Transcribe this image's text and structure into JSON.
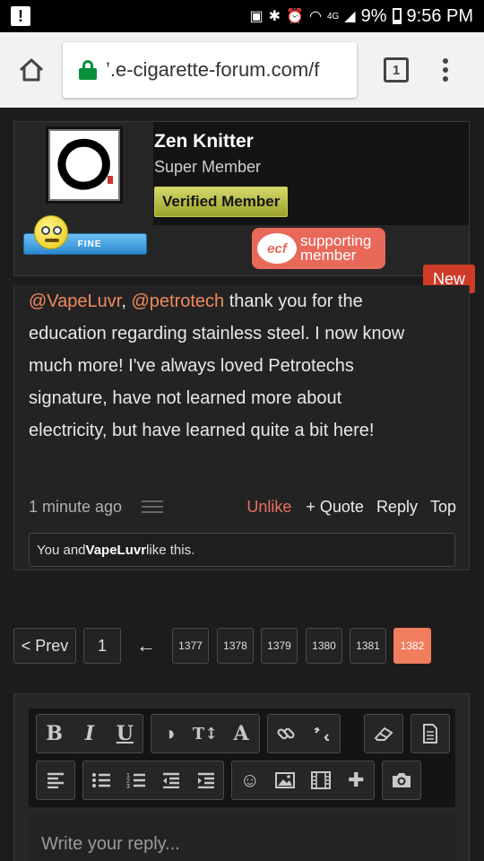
{
  "status_bar": {
    "notification": "!",
    "network": "4G",
    "battery": "9%",
    "time": "9:56 PM"
  },
  "browser": {
    "url": "’.e-cigarette-forum.com/f",
    "tab_count": "1"
  },
  "user": {
    "name": "Zen Knitter",
    "title": "Super Member",
    "badge": "Verified Member",
    "mood": "FINE",
    "supporting_logo": "ecf",
    "supporting_line1": "supporting",
    "supporting_line2": "member"
  },
  "post": {
    "new_badge": "New",
    "mention1": "@VapeLuvr",
    "separator": ", ",
    "mention2": "@petrotech",
    "text": " thank you for the education regarding stainless steel. I now know much more! I've always loved Petrotechs signature, have not learned more about electricity, but have learned quite a bit here!",
    "timestamp": "1 minute ago",
    "actions": {
      "unlike": "Unlike",
      "quote": "+ Quote",
      "reply": "Reply",
      "top": "Top"
    },
    "likes_prefix": "You and ",
    "likes_user": "VapeLuvr",
    "likes_suffix": " like this."
  },
  "pagination": {
    "prev": "< Prev",
    "first": "1",
    "back_arrow": "←",
    "pages": [
      "1377",
      "1378",
      "1379",
      "1380",
      "1381",
      "1382"
    ],
    "current": "1382"
  },
  "editor": {
    "placeholder": "Write your reply...",
    "row1": {
      "bold": "B",
      "italic": "I",
      "underline": "U",
      "contrast": "◑",
      "text_size": "T↕",
      "font": "A",
      "link": "link-icon",
      "unlink": "unlink-icon",
      "eraser": "eraser-icon",
      "document": "document-icon"
    },
    "row2": {
      "align": "align-left-icon",
      "bullets": "bullet-list-icon",
      "numbers": "numbered-list-icon",
      "outdent": "outdent-icon",
      "indent": "indent-icon",
      "smiley": "☺",
      "image": "image-icon",
      "media": "film-icon",
      "insert": "✚",
      "camera": "camera-icon"
    }
  }
}
